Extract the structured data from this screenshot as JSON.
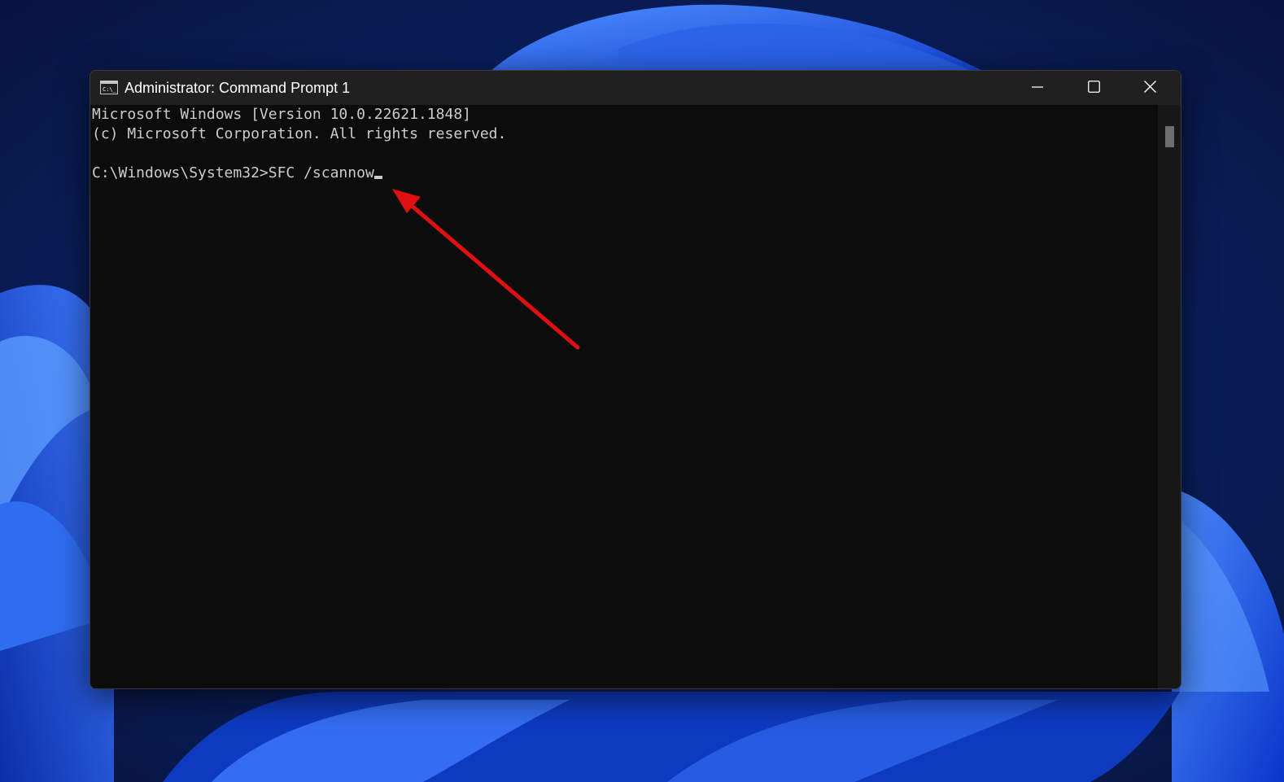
{
  "window": {
    "title": "Administrator: Command Prompt 1",
    "icon": "cmd-app-icon",
    "controls": {
      "minimize": "minimize-icon",
      "maximize": "maximize-icon",
      "close": "close-icon"
    }
  },
  "terminal": {
    "lines": [
      "Microsoft Windows [Version 10.0.22621.1848]",
      "(c) Microsoft Corporation. All rights reserved.",
      "",
      "C:\\Windows\\System32>SFC /scannow"
    ],
    "text_color": "#cccccc",
    "background": "#0c0c0c"
  },
  "annotation": {
    "arrow_color": "#e01010"
  },
  "colors": {
    "titlebar": "#202020",
    "wallpaper_accent": "#1a5cf0"
  }
}
